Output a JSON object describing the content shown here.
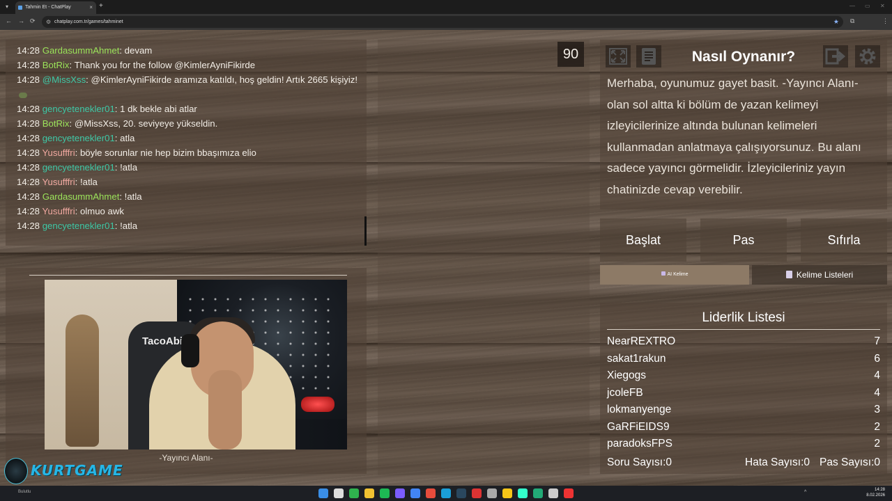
{
  "browser": {
    "tab_title": "Tahmin Et - ChatPlay",
    "tab_close": "×",
    "new_tab": "+",
    "url": "chatplay.com.tr/games/tahminet",
    "tab_menu": "▾",
    "minimize": "—",
    "maximize": "▭",
    "close_window": "✕",
    "back": "←",
    "forward": "→",
    "reload": "⟳",
    "lock": "⚙",
    "star": "★",
    "extensions": "⧉",
    "menu": "⋮"
  },
  "chat": {
    "messages": [
      {
        "time": "14:28",
        "user": "GardasummAhmet",
        "color": "#9be35a",
        "text": ": devam"
      },
      {
        "time": "14:28",
        "user": "BotRix",
        "color": "#9be35a",
        "text": ": Thank you for the follow @KimlerAyniFikirde"
      },
      {
        "time": "14:28",
        "user": "@MissXss",
        "color": "#3ec8a6",
        "text": ": @KimlerAyniFikirde aramıza katıldı, hoş geldin! Artık 2665 kişiyiz!"
      },
      {
        "time": "14:28",
        "user": "gencyetenekler01",
        "color": "#3ec8a6",
        "text": ": 1 dk bekle abi atlar"
      },
      {
        "time": "14:28",
        "user": "BotRix",
        "color": "#9be35a",
        "text": ": @MissXss, 20. seviyeye yükseldin."
      },
      {
        "time": "14:28",
        "user": "gencyetenekler01",
        "color": "#3ec8a6",
        "text": ": atla"
      },
      {
        "time": "14:28",
        "user": "Yusufffri",
        "color": "#f0a8a0",
        "text": ": böyle sorunlar nie hep bizim bbaşımıza elio"
      },
      {
        "time": "14:28",
        "user": "gencyetenekler01",
        "color": "#3ec8a6",
        "text": ": !atla"
      },
      {
        "time": "14:28",
        "user": "Yusufffri",
        "color": "#f0a8a0",
        "text": ": !atla"
      },
      {
        "time": "14:28",
        "user": "GardasummAhmet",
        "color": "#9be35a",
        "text": ": !atla"
      },
      {
        "time": "14:28",
        "user": "Yusufffri",
        "color": "#f0a8a0",
        "text": ": olmuo awk"
      },
      {
        "time": "14:28",
        "user": "gencyetenekler01",
        "color": "#3ec8a6",
        "text": ": !atla"
      }
    ]
  },
  "streamer": {
    "label": "-Yayıncı Alanı-",
    "chair_text": "TacoAbi"
  },
  "timer": "90",
  "howto": {
    "title": "Nasıl Oynanır?",
    "text": "Merhaba, oyunumuz gayet basit. -Yayıncı Alanı- olan sol altta ki bölüm de yazan kelimeyi izleyicilerinize altında bulunan kelimeleri kullanmadan anlatmaya çalışıyorsunuz. Bu alanı sadece yayıncı görmelidir. İzleyicileriniz yayın chatinizde cevap verebilir."
  },
  "controls": {
    "start": "Başlat",
    "pass": "Pas",
    "reset": "Sıfırla",
    "ai_word": "AI Kelime",
    "word_lists": "Kelime Listeleri"
  },
  "leaderboard": {
    "title": "Liderlik Listesi",
    "rows": [
      {
        "name": "NearREXTRO",
        "score": "7"
      },
      {
        "name": "sakat1rakun",
        "score": "6"
      },
      {
        "name": "Xiegogs",
        "score": "4"
      },
      {
        "name": "jcoleFB",
        "score": "4"
      },
      {
        "name": "lokmanyenge",
        "score": "3"
      },
      {
        "name": "GaRFiEIDS9",
        "score": "2"
      },
      {
        "name": "paradoksFPS",
        "score": "2"
      }
    ],
    "question_count": "Soru Sayısı:0",
    "error_count": "Hata Sayısı:0",
    "pass_count": "Pas Sayısı:0"
  },
  "overlay": {
    "logo_text": "KURTGAME"
  },
  "taskbar": {
    "status": "Bulutlu",
    "time": "14:28",
    "date": "8.02.2026"
  },
  "colors": {
    "accent_blue": "#27b6e6",
    "panel": "#504237"
  }
}
